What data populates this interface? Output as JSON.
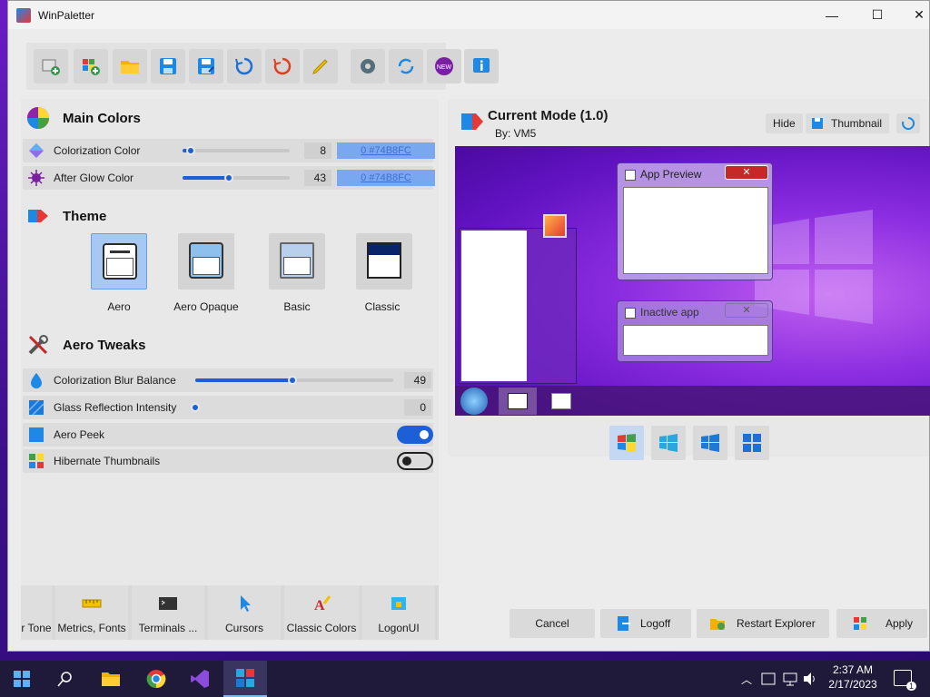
{
  "window": {
    "title": "WinPaletter",
    "minimize": "—",
    "maximize": "☐",
    "close": "✕"
  },
  "toolbar": {
    "buttons": [
      {
        "name": "new-from-current-button",
        "icon": "new-palette-icon"
      },
      {
        "name": "new-from-default-button",
        "icon": "new-default-icon"
      },
      {
        "name": "open-button",
        "icon": "folder-icon"
      },
      {
        "name": "save-button",
        "icon": "save-icon"
      },
      {
        "name": "save-as-button",
        "icon": "save-as-icon"
      },
      {
        "name": "reset-button",
        "icon": "refresh-icon"
      },
      {
        "name": "restore-button",
        "icon": "undo-icon"
      },
      {
        "name": "edit-info-button",
        "icon": "pencil-icon"
      },
      {
        "name": "settings-button",
        "icon": "gear-icon"
      },
      {
        "name": "update-button",
        "icon": "sync-icon"
      },
      {
        "name": "whats-new-button",
        "icon": "new-badge-icon",
        "badge": "NEW"
      },
      {
        "name": "about-button",
        "icon": "info-icon"
      }
    ]
  },
  "main_colors": {
    "title": "Main Colors",
    "colorization": {
      "label": "Colorization Color",
      "value": "8",
      "fraction": 0.08,
      "color_text": "0 #74B8FC"
    },
    "after_glow": {
      "label": "After Glow Color",
      "value": "43",
      "fraction": 0.43,
      "color_text": "0 #74B8FC"
    }
  },
  "theme": {
    "title": "Theme",
    "options": [
      {
        "label": "Aero",
        "selected": true
      },
      {
        "label": "Aero Opaque",
        "selected": false
      },
      {
        "label": "Basic",
        "selected": false
      },
      {
        "label": "Classic",
        "selected": false
      }
    ]
  },
  "aero_tweaks": {
    "title": "Aero Tweaks",
    "blur_balance": {
      "label": "Colorization Blur Balance",
      "value": "49",
      "fraction": 0.49
    },
    "glass_reflection": {
      "label": "Glass Reflection Intensity",
      "value": "0",
      "fraction": 0.0
    },
    "aero_peek": {
      "label": "Aero Peek",
      "on": true
    },
    "hibernate": {
      "label": "Hibernate Thumbnails",
      "on": false
    }
  },
  "current_mode": {
    "title": "Current Mode (1.0)",
    "author": "By: VM5",
    "hide_label": "Hide",
    "thumbnail_label": "Thumbnail"
  },
  "preview": {
    "active_window_title": "App Preview",
    "inactive_window_title": "Inactive app"
  },
  "bottom_tabs": [
    {
      "label": "r Tone",
      "icon": "tone-icon"
    },
    {
      "label": "Metrics, Fonts",
      "icon": "ruler-icon"
    },
    {
      "label": "Terminals ...",
      "icon": "terminal-icon"
    },
    {
      "label": "Cursors",
      "icon": "cursor-icon"
    },
    {
      "label": "Classic Colors",
      "icon": "classic-colors-icon"
    },
    {
      "label": "LogonUI",
      "icon": "lock-icon"
    }
  ],
  "actions": {
    "cancel": "Cancel",
    "logoff": "Logoff",
    "restart_explorer": "Restart Explorer",
    "apply": "Apply"
  },
  "taskbar": {
    "time": "2:37 AM",
    "date": "2/17/2023",
    "notification_count": "1"
  },
  "colors": {
    "accent": "#1c5fd6",
    "color_swatch": "#74B8FC",
    "taskbar": "#1f1a3a"
  }
}
